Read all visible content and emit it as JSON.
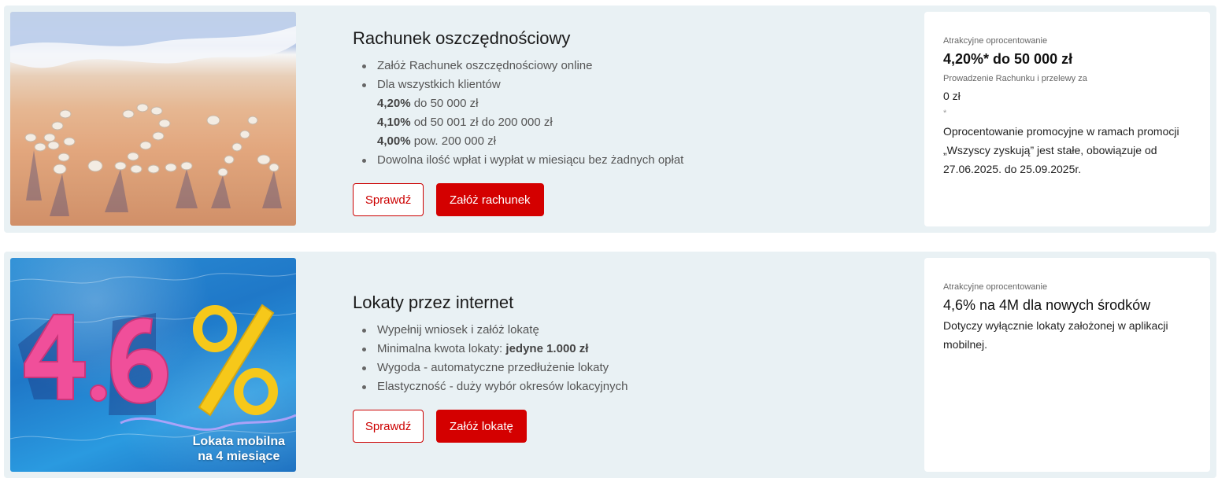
{
  "cards": [
    {
      "title": "Rachunek oszczędnościowy",
      "bullets": [
        "Załóż Rachunek oszczędnościowy online",
        "Dla wszystkich klientów"
      ],
      "rates": [
        {
          "rate": "4,20%",
          "range": " do 50 000 zł"
        },
        {
          "rate": "4,10%",
          "range": " od 50 001 zł do 200 000 zł"
        },
        {
          "rate": "4,00%",
          "range": " pow. 200 000 zł"
        }
      ],
      "last_bullet": "Dowolna ilość wpłat i wypłat w miesiącu bez żadnych opłat",
      "check_label": "Sprawdź",
      "cta_label": "Załóż rachunek",
      "image_caption": "",
      "side": {
        "label1": "Atrakcyjne oprocentowanie",
        "value1": "4,20%* do 50 000 zł",
        "label2": "Prowadzenie Rachunku i przelewy za",
        "value2": "0 zł",
        "footnote_mark": "*",
        "note": "Oprocentowanie promocyjne w ramach promocji „Wszyscy zyskują” jest stałe, obowiązuje od 27.06.2025. do 25.09.2025r."
      }
    },
    {
      "title": "Lokaty przez internet",
      "bullets_start": "Wypełnij wniosek i załóż lokatę",
      "min_label": "Minimalna kwota lokaty: ",
      "min_value": "jedyne 1.000 zł",
      "bullets_end": [
        "Wygoda - automatyczne przedłużenie lokaty",
        "Elastyczność - duży wybór okresów lokacyjnych"
      ],
      "check_label": "Sprawdź",
      "cta_label": "Załóż lokatę",
      "image_caption_line1": "Lokata mobilna",
      "image_caption_line2": "na 4 miesiące",
      "side": {
        "label1": "Atrakcyjne oprocentowanie",
        "value1": "4,6% na 4M dla nowych środków",
        "note": "Dotyczy wyłącznie lokaty założonej w aplikacji mobilnej."
      }
    }
  ],
  "colors": {
    "accent": "#d40000",
    "card_bg": "#e9f1f4"
  }
}
